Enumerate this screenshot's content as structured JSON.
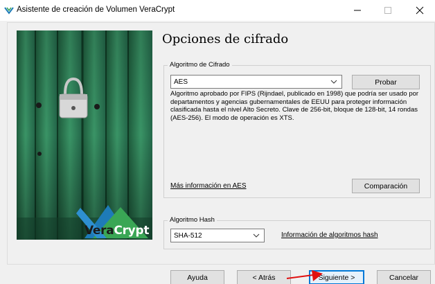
{
  "window": {
    "title": "Asistente de creación de Volumen VeraCrypt",
    "controls": {
      "minimize": "–",
      "maximize": "☐",
      "close": "✕"
    }
  },
  "sidebar": {
    "brand_part1": "Vera",
    "brand_part2": "Crypt"
  },
  "page": {
    "title": "Opciones de cifrado"
  },
  "encryption": {
    "group_label": "Algoritmo de Cifrado",
    "selected": "AES",
    "test_button": "Probar",
    "description": "Algoritmo aprobado por FIPS (Rijndael, publicado en 1998) que podría ser usado por departamentos y agencias gubernamentales de EEUU para proteger información clasificada hasta el nivel Alto Secreto. Clave de 256-bit, bloque de 128-bit, 14 rondas (AES-256). El modo de operación es XTS.",
    "more_info_link": "Más información en AES",
    "benchmark_button": "Comparación"
  },
  "hash": {
    "group_label": "Algoritmo Hash",
    "selected": "SHA-512",
    "info_link": "Información de algoritmos hash"
  },
  "footer": {
    "help_button": "Ayuda",
    "back_button": "< Atrás",
    "next_button": "Siguiente >",
    "cancel_button": "Cancelar"
  },
  "colors": {
    "focus_blue": "#0078d7",
    "annotation_red": "#e01010",
    "image_green": "#2c7a52"
  },
  "icons": {
    "title": "veracrypt-logo-icon",
    "dropdown": "chevron-down-icon",
    "annotation": "red-arrow-annotation"
  }
}
